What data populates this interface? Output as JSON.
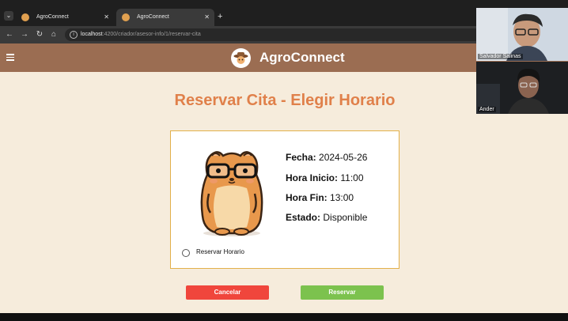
{
  "browser": {
    "tabs": [
      {
        "label": "AgroConnect",
        "active": false
      },
      {
        "label": "AgroConnect",
        "active": true
      }
    ],
    "url_host": "localhost",
    "url_path": ":4200/criador/asesor-info/1/reservar-cita"
  },
  "app": {
    "brand": "AgroConnect"
  },
  "page": {
    "title": "Reservar Cita - Elegir Horario"
  },
  "appointment": {
    "fecha_label": "Fecha:",
    "fecha_value": "2024-05-26",
    "hora_inicio_label": "Hora Inicio:",
    "hora_inicio_value": "11:00",
    "hora_fin_label": "Hora Fin:",
    "hora_fin_value": "13:00",
    "estado_label": "Estado:",
    "estado_value": "Disponible",
    "radio_label": "Reservar Horario",
    "radio_checked": false
  },
  "actions": {
    "cancel_label": "Cancelar",
    "reserve_label": "Reservar"
  },
  "video_call": {
    "participants": [
      {
        "name": "Salvador Salinas"
      },
      {
        "name": "Ander"
      }
    ]
  },
  "colors": {
    "header": "#9b6d52",
    "title": "#e0804a",
    "background": "#f6ecdc",
    "cancel": "#f0463c",
    "reserve": "#7cc24e",
    "card_border": "#e2b04a"
  }
}
